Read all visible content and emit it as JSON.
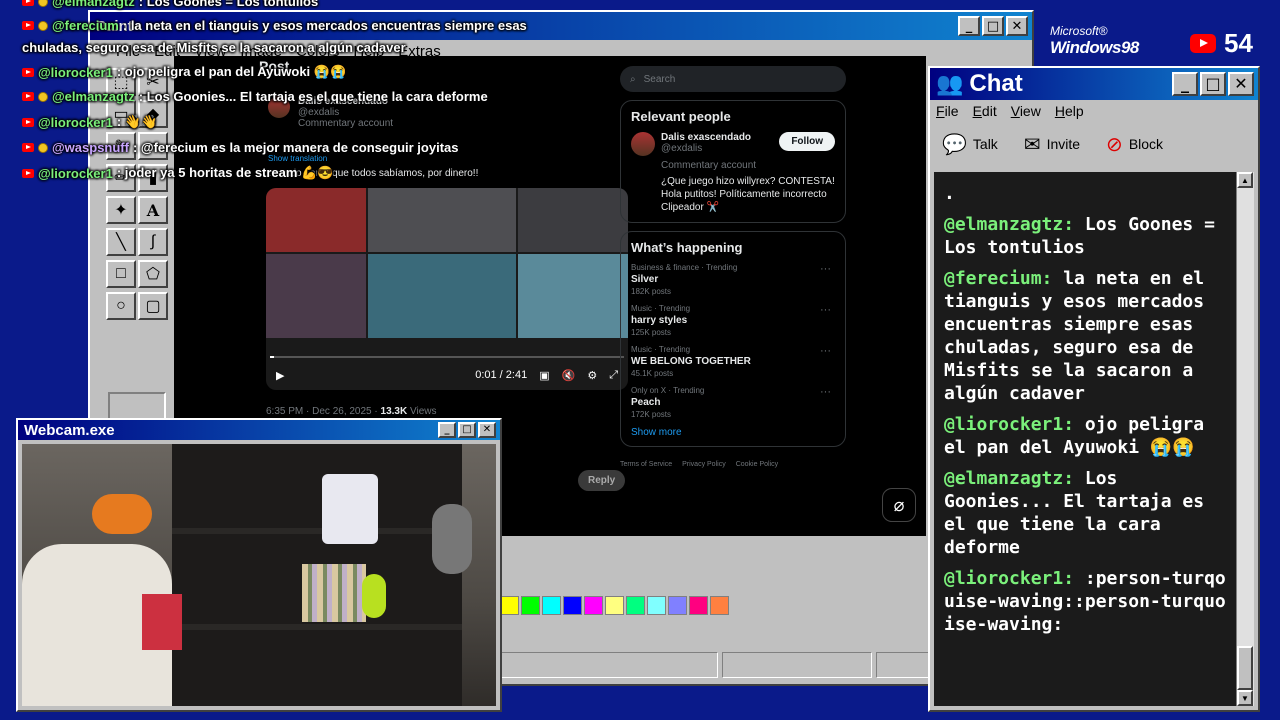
{
  "paint": {
    "title": "Paint",
    "menu": [
      "File",
      "Edit",
      "View",
      "Image",
      "Colors",
      "Help",
      "Extras"
    ],
    "palette": [
      "#ffff00",
      "#00ff00",
      "#00ffff",
      "#0000ff",
      "#ff00ff",
      "#ffff80",
      "#00ff80",
      "#80ffff",
      "#8080ff",
      "#ff0080",
      "#ff8040"
    ]
  },
  "x": {
    "post_header": "Post",
    "author_name": "Dalis exascendado",
    "author_handle": "@exdalis",
    "author_tag": "Commentary account",
    "show_translation": "Show translation",
    "tweet_text": "...sendo por lo que todos sabíamos, por dinero!!",
    "video_time": "0:01 / 2:41",
    "meta_time": "6:35 PM · Dec 26, 2025 · ",
    "meta_views_num": "13.3K",
    "meta_views": " Views",
    "reply_label": "Reply",
    "search_placeholder": "Search",
    "relevant_title": "Relevant people",
    "rp_name": "Dalis exascendado",
    "rp_handle": "@exdalis",
    "rp_tag": "Commentary account",
    "follow_label": "Follow",
    "rp_bio": "¿Que juego hizo willyrex? CONTESTA! Hola putitos! Políticamente incorrecto Clipeador ✂️",
    "happening_title": "What’s happening",
    "trends": [
      {
        "cat": "Business & finance · Trending",
        "name": "Silver",
        "posts": "182K posts"
      },
      {
        "cat": "Music · Trending",
        "name": "harry styles",
        "posts": "125K posts"
      },
      {
        "cat": "Music · Trending",
        "name": "WE BELONG TOGETHER",
        "posts": "45.1K posts"
      },
      {
        "cat": "Only on X · Trending",
        "name": "Peach",
        "posts": "172K posts"
      }
    ],
    "show_more": "Show more",
    "footer": [
      "Terms of Service",
      "Privacy Policy",
      "Cookie Policy"
    ]
  },
  "overlay": [
    {
      "user": "@elmanzagtz",
      "text": ": Los Goones = Los tontulios",
      "coin": true
    },
    {
      "user": "@ferecium",
      "text": ": la neta en el tianguis y esos mercados encuentras siempre esas",
      "coin": true
    },
    {
      "user": "",
      "text": "chuladas, seguro esa de Misfits se la sacaron a algún cadaver",
      "coin": false
    },
    {
      "user": "@liorocker1",
      "text": ": ojo peligra el pan del Ayuwoki 😭😭",
      "coin": false
    },
    {
      "user": "@elmanzagtz",
      "text": ": Los Goonies... El tartaja es el que tiene la cara deforme",
      "coin": true
    },
    {
      "user": "@liorocker1",
      "text": ": 👋👋",
      "coin": false
    },
    {
      "user": "@waspsnuff",
      "text": ": @ferecium es la mejor manera de conseguir joyitas",
      "coin": true,
      "pink": true
    },
    {
      "user": "@liorocker1",
      "text": ": joder ya 5 horitas de stream 💪😎",
      "coin": false
    }
  ],
  "branding": {
    "ms": "Microsoft®",
    "win": "Windows98",
    "viewers": "54"
  },
  "chat": {
    "title": "Chat",
    "menu": [
      "File",
      "Edit",
      "View",
      "Help"
    ],
    "tools": [
      {
        "icon": "talk-icon",
        "label": "Talk"
      },
      {
        "icon": "invite-icon",
        "label": "Invite"
      },
      {
        "icon": "block-icon",
        "label": "Block"
      }
    ],
    "messages": [
      {
        "user": "",
        "text": "."
      },
      {
        "user": "@elmanzagtz:",
        "text": " Los Goones = Los tontulios"
      },
      {
        "user": "@ferecium:",
        "text": " la neta en el tianguis y esos mercados encuentras siempre esas chuladas, seguro esa de Misfits se la sacaron a algún cadaver"
      },
      {
        "user": "@liorocker1:",
        "text": " ojo peligra el pan del Ayuwoki 😭😭"
      },
      {
        "user": "@elmanzagtz:",
        "text": " Los Goonies... El tartaja es el que tiene la cara deforme"
      },
      {
        "user": "@liorocker1:",
        "text": " :person-turqouise-waving::person-turquoise-waving:"
      }
    ]
  },
  "webcam": {
    "title": "Webcam.exe"
  }
}
